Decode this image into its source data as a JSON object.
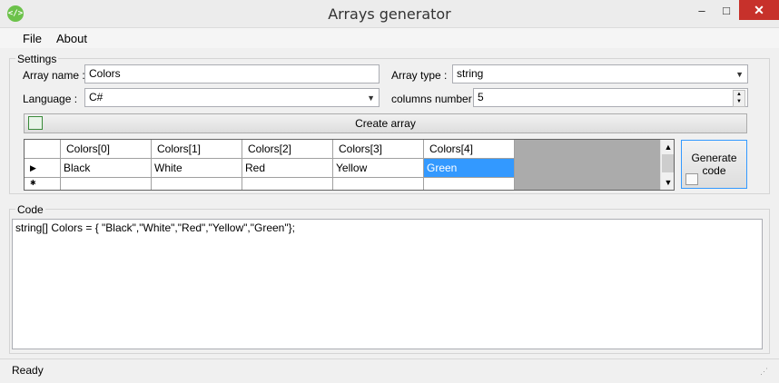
{
  "window": {
    "title": "Arrays generator",
    "icon_glyph": "</>",
    "minimize_glyph": "–",
    "maximize_glyph": "□",
    "close_glyph": "✕"
  },
  "menu": {
    "file": "File",
    "about": "About"
  },
  "settings": {
    "group_label": "Settings",
    "array_name_label": "Array name :",
    "array_name_value": "Colors",
    "array_type_label": "Array type :",
    "array_type_value": "string",
    "language_label": "Language :",
    "language_value": "C#",
    "columns_label": "columns number :",
    "columns_value": "5",
    "create_button": "Create array"
  },
  "grid": {
    "headers": [
      "Colors[0]",
      "Colors[1]",
      "Colors[2]",
      "Colors[3]",
      "Colors[4]"
    ],
    "row": [
      "Black",
      "White",
      "Red",
      "Yellow",
      "Green"
    ],
    "selected_index": 4
  },
  "generate_button": {
    "line1": "Generate",
    "line2": "code"
  },
  "code": {
    "group_label": "Code",
    "text": "string[] Colors = { \"Black\",\"White\",\"Red\",\"Yellow\",\"Green\"};"
  },
  "status": {
    "text": "Ready"
  },
  "colors": {
    "selection": "#3399ff",
    "close_button": "#c7312b"
  }
}
